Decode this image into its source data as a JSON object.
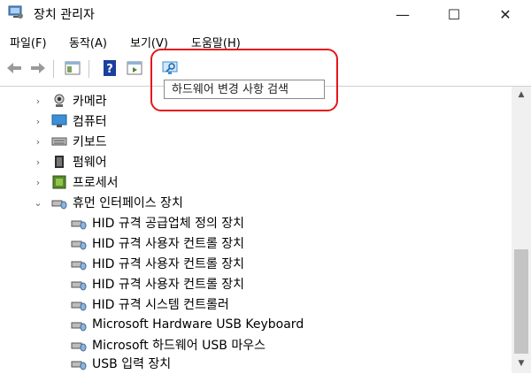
{
  "window": {
    "title": "장치 관리자",
    "minimize": "—",
    "maximize": "☐",
    "close": "✕"
  },
  "menu": [
    {
      "label": "파일(F)"
    },
    {
      "label": "동작(A)"
    },
    {
      "label": "보기(V)"
    },
    {
      "label": "도움말(H)"
    }
  ],
  "tooltip": {
    "text": "하드웨어 변경 사항 검색"
  },
  "tree": {
    "collapsed": [
      {
        "label": "카메라",
        "icon": "camera-icon"
      },
      {
        "label": "컴퓨터",
        "icon": "computer-icon"
      },
      {
        "label": "키보드",
        "icon": "keyboard-icon"
      },
      {
        "label": "펌웨어",
        "icon": "firmware-icon"
      },
      {
        "label": "프로세서",
        "icon": "processor-icon"
      }
    ],
    "expanded": {
      "label": "휴먼 인터페이스 장치",
      "icon": "hid-icon",
      "children": [
        {
          "label": "HID 규격 공급업체 정의 장치"
        },
        {
          "label": "HID 규격 사용자 컨트롤 장치"
        },
        {
          "label": "HID 규격 사용자 컨트롤 장치"
        },
        {
          "label": "HID 규격 사용자 컨트롤 장치"
        },
        {
          "label": "HID 규격 시스템 컨트롤러"
        },
        {
          "label": "Microsoft Hardware USB Keyboard"
        },
        {
          "label": "Microsoft 하드웨어 USB 마우스"
        },
        {
          "label": "USB 입력 장치"
        }
      ]
    }
  },
  "colors": {
    "highlight": "#e5151b",
    "scan_icon": "#3d8fd6"
  }
}
